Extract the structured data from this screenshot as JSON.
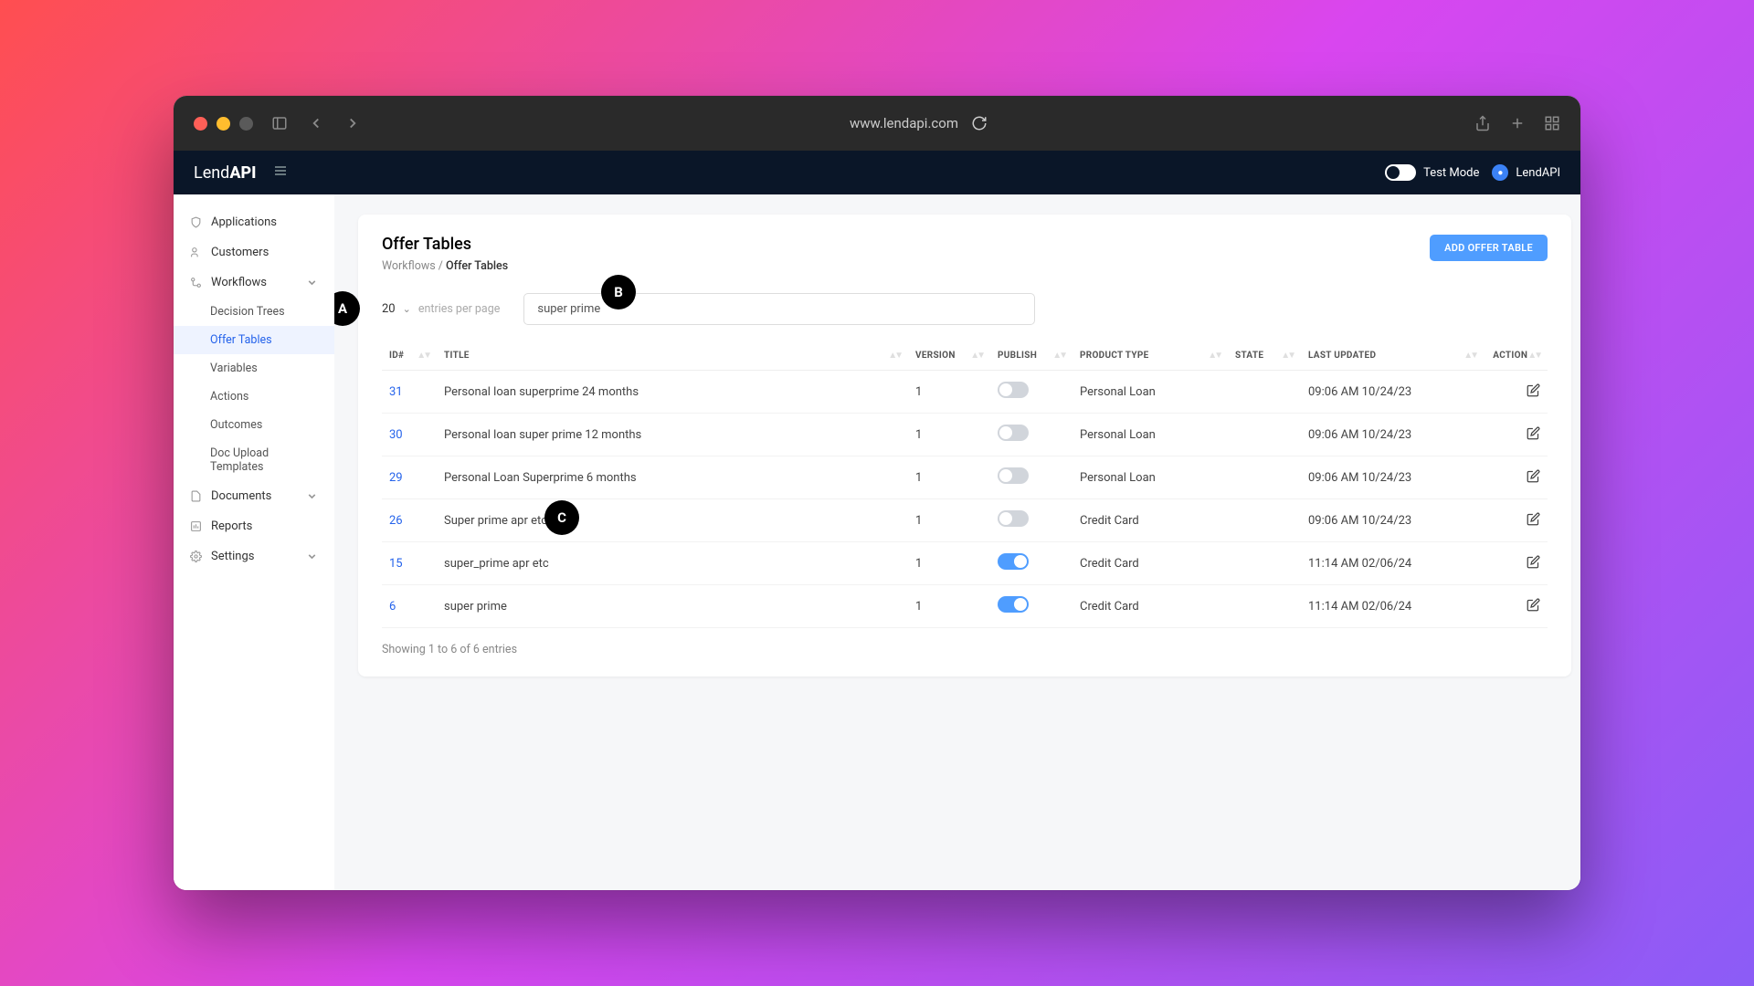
{
  "browser": {
    "url": "www.lendapi.com"
  },
  "app": {
    "logo_prefix": "Lend",
    "logo_suffix": "API",
    "test_mode_label": "Test Mode",
    "org_name": "LendAPI"
  },
  "sidebar": {
    "items": [
      {
        "label": "Applications",
        "icon": "shield"
      },
      {
        "label": "Customers",
        "icon": "users"
      },
      {
        "label": "Workflows",
        "icon": "flow",
        "expanded": true
      },
      {
        "label": "Documents",
        "icon": "doc",
        "expandable": true
      },
      {
        "label": "Reports",
        "icon": "report"
      },
      {
        "label": "Settings",
        "icon": "gear",
        "expandable": true
      }
    ],
    "workflow_children": [
      {
        "label": "Decision Trees"
      },
      {
        "label": "Offer Tables",
        "active": true
      },
      {
        "label": "Variables"
      },
      {
        "label": "Actions"
      },
      {
        "label": "Outcomes"
      },
      {
        "label": "Doc Upload Templates"
      }
    ]
  },
  "page": {
    "title": "Offer Tables",
    "breadcrumb_parent": "Workflows",
    "breadcrumb_sep": " / ",
    "breadcrumb_current": "Offer Tables",
    "add_button": "ADD OFFER TABLE",
    "entries_value": "20",
    "entries_label": "entries per page",
    "search_value": "super prime",
    "footer": "Showing 1 to 6 of 6 entries"
  },
  "table": {
    "headers": {
      "id": "ID#",
      "title": "TITLE",
      "version": "VERSION",
      "publish": "PUBLISH",
      "product_type": "PRODUCT TYPE",
      "state": "STATE",
      "last_updated": "LAST UPDATED",
      "action": "ACTION"
    },
    "rows": [
      {
        "id": "31",
        "title": "Personal loan superprime 24 months",
        "version": "1",
        "publish": false,
        "product_type": "Personal Loan",
        "state": "",
        "last_updated": "09:06 AM 10/24/23"
      },
      {
        "id": "30",
        "title": "Personal loan super prime 12 months",
        "version": "1",
        "publish": false,
        "product_type": "Personal Loan",
        "state": "",
        "last_updated": "09:06 AM 10/24/23"
      },
      {
        "id": "29",
        "title": "Personal Loan Superprime 6 months",
        "version": "1",
        "publish": false,
        "product_type": "Personal Loan",
        "state": "",
        "last_updated": "09:06 AM 10/24/23"
      },
      {
        "id": "26",
        "title": "Super prime apr etc new",
        "version": "1",
        "publish": false,
        "product_type": "Credit Card",
        "state": "",
        "last_updated": "09:06 AM 10/24/23"
      },
      {
        "id": "15",
        "title": "super_prime apr etc",
        "version": "1",
        "publish": true,
        "product_type": "Credit Card",
        "state": "",
        "last_updated": "11:14 AM 02/06/24"
      },
      {
        "id": "6",
        "title": "super prime",
        "version": "1",
        "publish": true,
        "product_type": "Credit Card",
        "state": "",
        "last_updated": "11:14 AM 02/06/24"
      }
    ]
  },
  "markers": {
    "A": "A",
    "B": "B",
    "C": "C"
  }
}
